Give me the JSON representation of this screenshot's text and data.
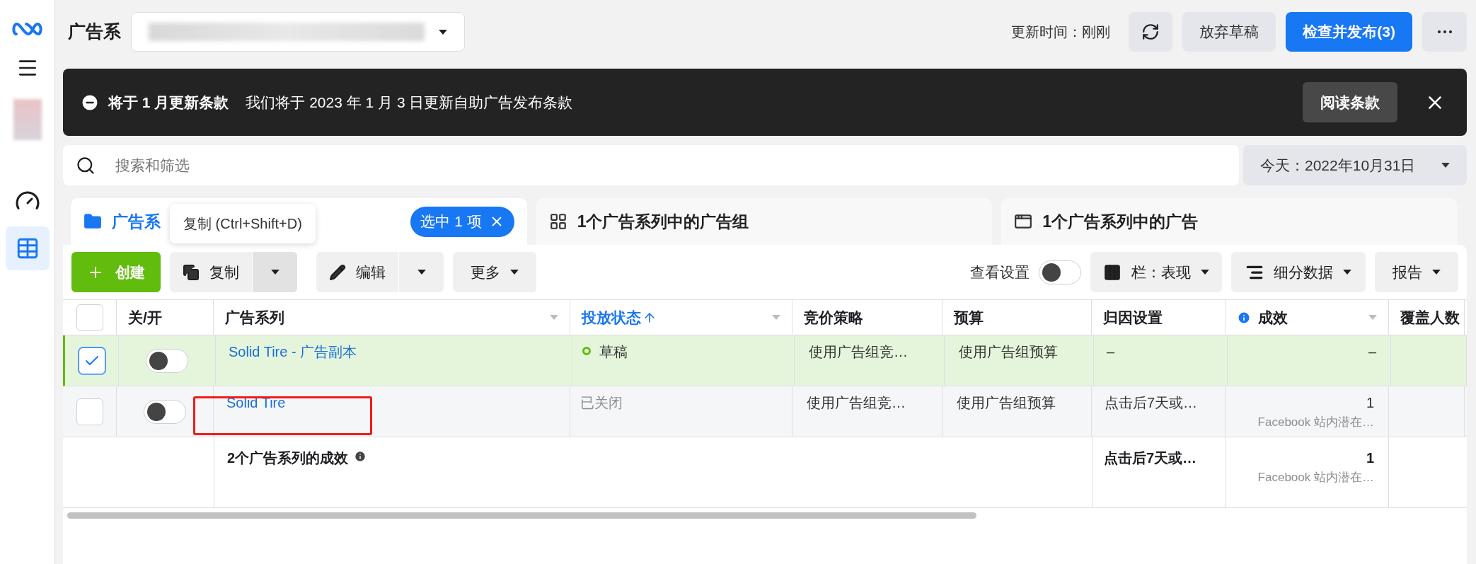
{
  "header": {
    "title": "广告系",
    "updated": "更新时间：刚刚",
    "discard": "放弃草稿",
    "publish": "检查并发布(3)"
  },
  "banner": {
    "title": "将于 1 月更新条款",
    "text": "我们将于 2023 年 1 月 3 日更新自助广告发布条款",
    "button": "阅读条款"
  },
  "search": {
    "placeholder": "搜索和筛选"
  },
  "date": "今天：2022年10月31日",
  "tabs": [
    {
      "label": "广告系",
      "selected": true,
      "kind": "campaign",
      "badge": "选中 1 项"
    },
    {
      "label": "1个广告系列中的广告组",
      "selected": false,
      "kind": "adset"
    },
    {
      "label": "1个广告系列中的广告",
      "selected": false,
      "kind": "ad"
    }
  ],
  "tooltip": "复制 (Ctrl+Shift+D)",
  "toolbar": {
    "create": "创建",
    "duplicate": "复制",
    "edit": "编辑",
    "more": "更多",
    "view_settings": "查看设置",
    "view_settings_on": false,
    "columns": "栏：表现",
    "breakdown": "细分数据",
    "reports": "报告"
  },
  "table": {
    "all_selected": false,
    "columns": [
      {
        "label": "关/开",
        "sorted": false,
        "menu": false,
        "info": false
      },
      {
        "label": "广告系列",
        "sorted": false,
        "menu": true,
        "info": false
      },
      {
        "label": "投放状态",
        "sorted": true,
        "menu": true,
        "info": false
      },
      {
        "label": "竞价策略",
        "sorted": false,
        "menu": false,
        "info": false
      },
      {
        "label": "预算",
        "sorted": false,
        "menu": false,
        "info": false
      },
      {
        "label": "归因设置",
        "sorted": false,
        "menu": false,
        "info": false
      },
      {
        "label": "成效",
        "sorted": false,
        "menu": true,
        "info": true
      },
      {
        "label": "覆盖人数",
        "sorted": false
      }
    ],
    "rows": [
      {
        "selected": true,
        "on": false,
        "name": "Solid Tire - 广告副本",
        "status": "草稿",
        "kind": "draft",
        "bid": "使用广告组竞…",
        "budget": "使用广告组预算",
        "attribution": "–",
        "results": "–"
      },
      {
        "selected": false,
        "on": false,
        "name": "Solid Tire",
        "status": "已关闭",
        "kind": "off",
        "bid": "使用广告组竞…",
        "budget": "使用广告组预算",
        "attribution": "点击后7天或…",
        "results": "1",
        "results_sub": "Facebook 站内潜在…"
      }
    ],
    "summary": {
      "label": "2个广告系列的成效",
      "attribution": "点击后7天或…",
      "results": "1",
      "results_sub": "Facebook 站内潜在…"
    }
  }
}
